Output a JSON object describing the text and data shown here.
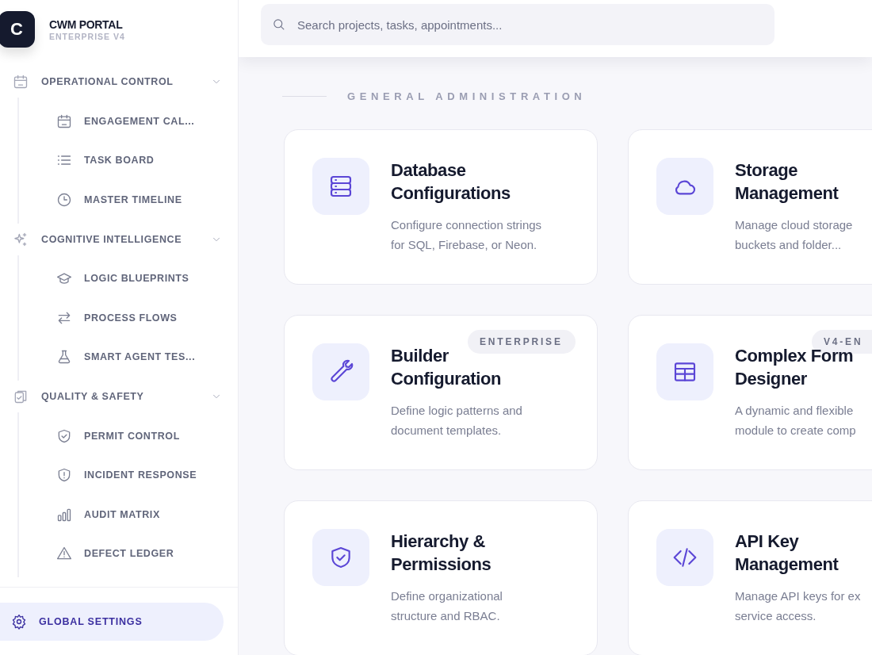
{
  "brand": {
    "logo": "C",
    "name": "CWM PORTAL",
    "edition": "ENTERPRISE V4"
  },
  "nav": [
    {
      "label": "OPERATIONAL CONTROL",
      "expanded": true,
      "children": [
        {
          "label": "ENGAGEMENT CAL...",
          "selected": false
        },
        {
          "label": "TASK BOARD",
          "selected": false
        },
        {
          "label": "MASTER TIMELINE",
          "selected": false
        }
      ]
    },
    {
      "label": "COGNITIVE INTELLIGENCE",
      "expanded": true,
      "children": [
        {
          "label": "LOGIC BLUEPRINTS",
          "selected": false
        },
        {
          "label": "PROCESS FLOWS",
          "selected": false
        },
        {
          "label": "SMART AGENT TES...",
          "selected": false
        }
      ]
    },
    {
      "label": "QUALITY & SAFETY",
      "expanded": true,
      "children": [
        {
          "label": "PERMIT CONTROL",
          "selected": false
        },
        {
          "label": "INCIDENT RESPONSE",
          "selected": false
        },
        {
          "label": "AUDIT MATRIX",
          "selected": false
        },
        {
          "label": "DEFECT LEDGER",
          "selected": false
        }
      ]
    }
  ],
  "settings": {
    "label": "GLOBAL SETTINGS",
    "selected": true
  },
  "search": {
    "placeholder": "Search projects, tasks, appointments..."
  },
  "section": {
    "title": "GENERAL ADMINISTRATION"
  },
  "cards": [
    {
      "title_lines": [
        "Database",
        "Configurations"
      ],
      "description_lines": [
        "Configure connection strings",
        "for SQL, Firebase, or Neon."
      ]
    },
    {
      "title_lines": [
        "Storage",
        "Management"
      ],
      "description_lines": [
        "Manage cloud storage",
        "buckets and folder..."
      ]
    },
    {
      "title_lines": [
        "Builder",
        "Configuration"
      ],
      "badge": "ENTERPRISE",
      "description_lines": [
        "Define logic patterns and",
        "document templates."
      ]
    },
    {
      "title_lines": [
        "Complex Form",
        "Designer"
      ],
      "badge": "V4-EN",
      "description_lines": [
        "A dynamic and flexible",
        "module to create comp"
      ]
    },
    {
      "title_lines": [
        "Hierarchy &",
        "Permissions"
      ],
      "description_lines": [
        "Define organizational",
        "structure and RBAC."
      ]
    },
    {
      "title_lines": [
        "API Key",
        "Management"
      ],
      "description_lines": [
        "Manage API keys for ex",
        "service access."
      ]
    }
  ]
}
